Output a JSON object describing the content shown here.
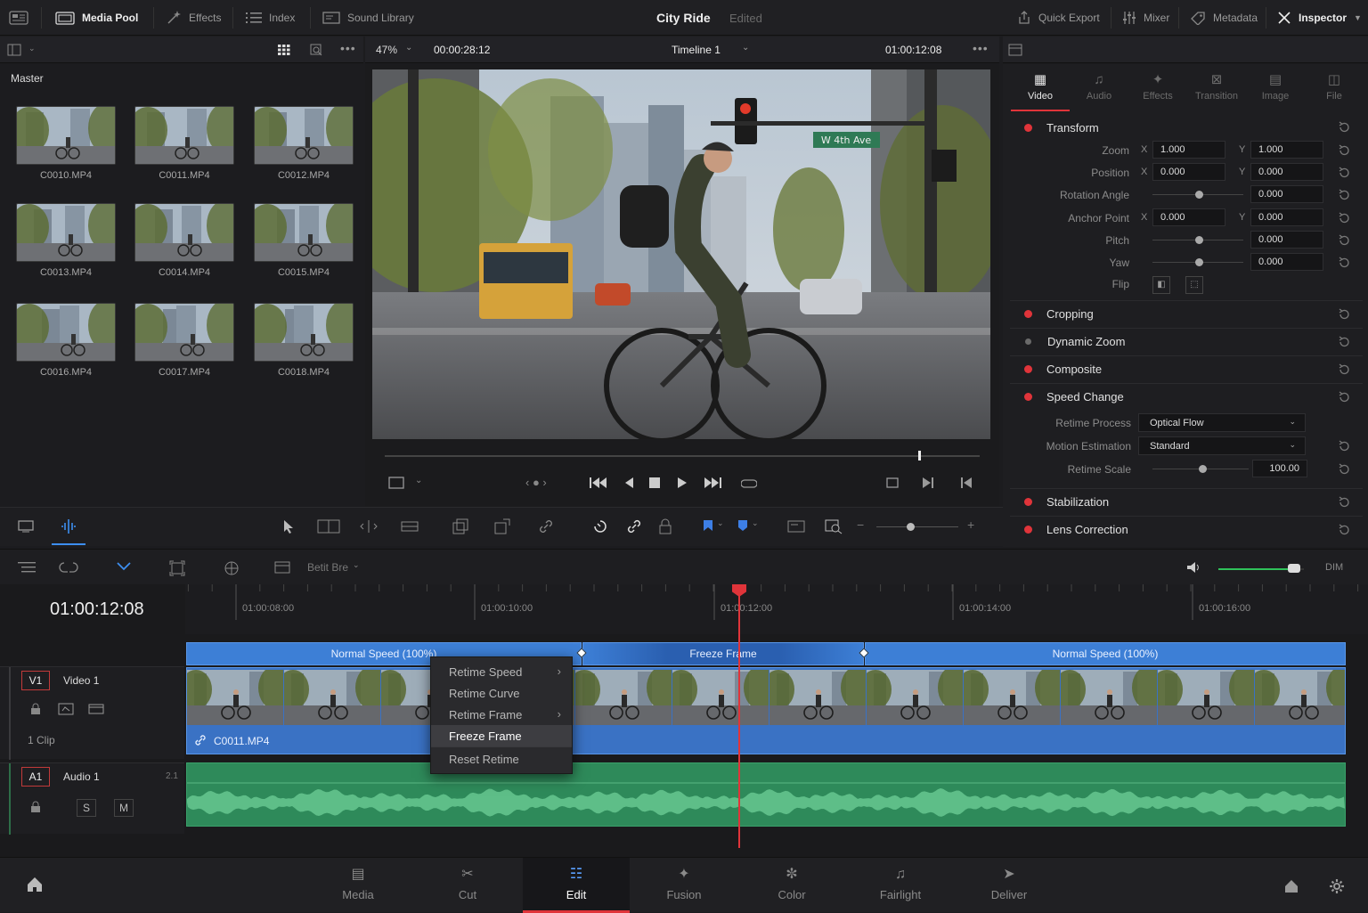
{
  "topbar": {
    "media_pool": "Media Pool",
    "effects": "Effects",
    "index": "Index",
    "sound_library": "Sound Library",
    "project_title": "City Ride",
    "project_status": "Edited",
    "quick_export": "Quick Export",
    "mixer": "Mixer",
    "metadata": "Metadata",
    "inspector": "Inspector"
  },
  "media_pool": {
    "folder": "Master",
    "clips": [
      "C0010.MP4",
      "C0011.MP4",
      "C0012.MP4",
      "C0013.MP4",
      "C0014.MP4",
      "C0015.MP4",
      "C0016.MP4",
      "C0017.MP4",
      "C0018.MP4"
    ]
  },
  "viewer": {
    "zoom": "47%",
    "duration": "00:00:28:12",
    "timeline_name": "Timeline 1",
    "timecode": "01:00:12:08",
    "scrub_position": 0.896,
    "street_sign": "W 4th Ave"
  },
  "inspector": {
    "tabs": [
      "Video",
      "Audio",
      "Effects",
      "Transition",
      "Image",
      "File"
    ],
    "active_tab": "Video",
    "transform": {
      "label": "Transform",
      "zoom_label": "Zoom",
      "zoom_x": "1.000",
      "zoom_y": "1.000",
      "position_label": "Position",
      "position_x": "0.000",
      "position_y": "0.000",
      "rotation_label": "Rotation Angle",
      "rotation": "0.000",
      "anchor_label": "Anchor Point",
      "anchor_x": "0.000",
      "anchor_y": "0.000",
      "pitch_label": "Pitch",
      "pitch": "0.000",
      "yaw_label": "Yaw",
      "yaw": "0.000",
      "flip_label": "Flip",
      "x": "X",
      "y": "Y"
    },
    "sections": {
      "cropping": "Cropping",
      "dynamic_zoom": "Dynamic Zoom",
      "composite": "Composite",
      "speed_change": "Speed Change",
      "stabilization": "Stabilization",
      "lens_correction": "Lens Correction"
    },
    "speed": {
      "retime_process_label": "Retime Process",
      "retime_process": "Optical Flow",
      "motion_estimation_label": "Motion Estimation",
      "motion_estimation": "Standard",
      "retime_scale_label": "Retime Scale",
      "retime_scale": "100.00"
    }
  },
  "timeline": {
    "timecode": "01:00:12:08",
    "edit_mode": "Betit Bre",
    "dim": "DIM",
    "ruler_marks": [
      "01:00:08:00",
      "01:00:10:00",
      "01:00:12:00",
      "01:00:14:00",
      "01:00:16:00"
    ],
    "speed_segments": [
      "Normal Speed (100%)",
      "Freeze Frame",
      "Normal Speed (100%)"
    ],
    "video_track": {
      "id": "V1",
      "name": "Video 1",
      "count": "1 Clip",
      "clip_name": "C0011.MP4"
    },
    "audio_track": {
      "id": "A1",
      "name": "Audio 1",
      "channels": "2.1",
      "solo": "S",
      "mute": "M"
    },
    "volume_level": 0.88
  },
  "context_menu": {
    "items": [
      "Retime Speed",
      "Retime Curve",
      "Retime Frame",
      "Freeze Frame",
      "Reset Retime"
    ],
    "highlighted": "Freeze Frame"
  },
  "pages": [
    "Media",
    "Cut",
    "Edit",
    "Fusion",
    "Color",
    "Fairlight",
    "Deliver"
  ],
  "active_page": "Edit",
  "colors": {
    "accent": "#e0343a",
    "clip_blue": "#3d7fd6",
    "audio_green": "#2e8a5a"
  }
}
